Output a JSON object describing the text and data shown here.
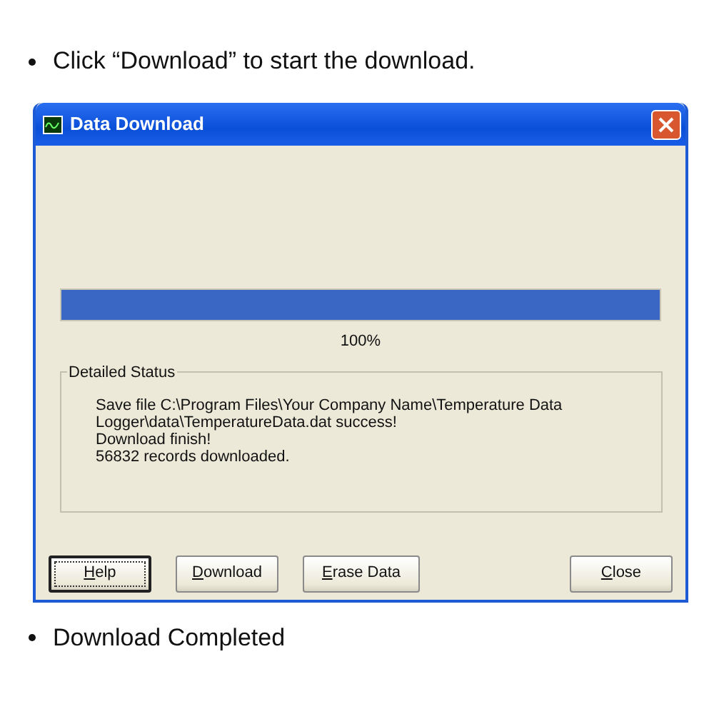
{
  "steps_before": [
    {
      "text": "Click “Download” to start the download."
    }
  ],
  "window": {
    "title": "Data Download",
    "progress": {
      "level": 1.0,
      "reading": "100%"
    },
    "status_group": {
      "title": "Detailed Status",
      "lines": [
        "Save file C:\\Program Files\\Your Company Name\\Temperature Data Logger\\data\\TemperatureData.dat success!",
        "Download finish!",
        "56832 records downloaded."
      ]
    },
    "buttons": [
      {
        "label": "Help",
        "focused": true
      },
      {
        "label": "Download",
        "focused": false
      },
      {
        "label": "Erase Data",
        "focused": false
      },
      {
        "label": "Close",
        "focused": false
      }
    ]
  },
  "steps_after": [
    {
      "text": "Download Completed"
    }
  ]
}
